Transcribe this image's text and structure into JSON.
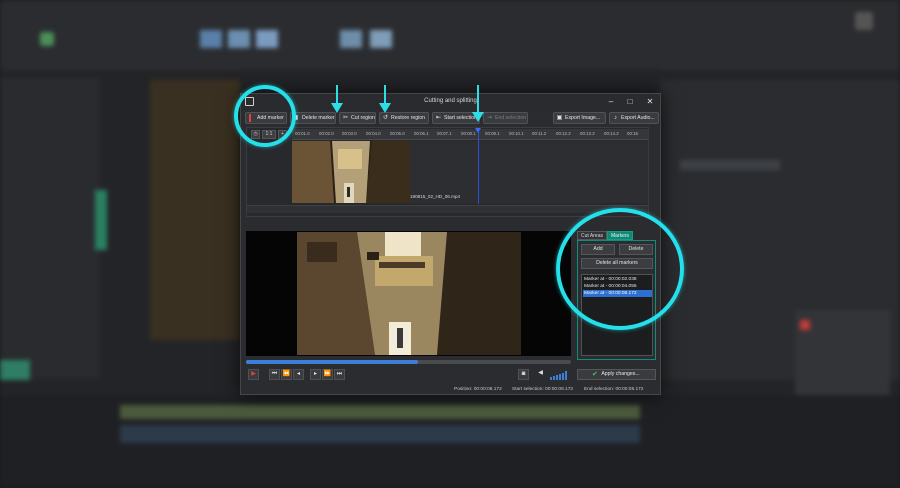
{
  "dialog": {
    "title": "Cutting and splitting",
    "toolbar": {
      "add_marker": "Add marker",
      "delete_marker": "Delete marker",
      "cut_region": "Cut region",
      "restore_region": "Restore region",
      "start_selection": "Start selection",
      "end_selection": "End selection",
      "export_image": "Export Image...",
      "export_audio": "Export Audio..."
    },
    "timeline": {
      "ruler_labels": [
        "00:01.0",
        "00:02.0",
        "00:03.0",
        "00:04.0",
        "00:05.0",
        "00:06.1",
        "00:07.1",
        "00:08.1",
        "00:09.1",
        "00:10.1",
        "00:11.2",
        "00:12.2",
        "00:13.2",
        "00:14.2",
        "00:15"
      ],
      "clip_name": "190815_02_HD_06.mp4",
      "zoom_label": "1:1"
    },
    "side_panel": {
      "tabs": [
        "Cut Areas",
        "Markers"
      ],
      "active_tab": "Markers",
      "add": "Add",
      "delete": "Delete",
      "delete_all": "Delete all markers",
      "markers": [
        {
          "label": "Marker at - 00:00:02.038",
          "selected": false
        },
        {
          "label": "Marker at - 00:00:04.055",
          "selected": false
        },
        {
          "label": "Marker at - 00:00:08.172",
          "selected": true
        }
      ]
    },
    "apply_label": "Apply changes...",
    "status": {
      "position": "Position: 00:00:08.172",
      "start_selection": "Start selection: 00:00:08.172",
      "end_selection": "End selection: 00:00:08.172"
    },
    "seek_progress": 0.53
  },
  "colors": {
    "accent_teal": "#0e8a74",
    "annotation_cyan": "#23e0ea",
    "selection_blue": "#2d6fd2",
    "marker_red": "#e0433d"
  }
}
